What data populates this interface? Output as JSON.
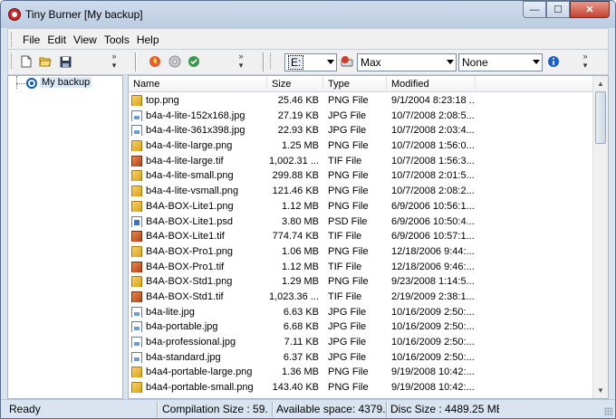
{
  "window": {
    "title": "Tiny Burner [My backup]",
    "buttons": {
      "minimize": "—",
      "maximize": "☐",
      "close": "✕"
    }
  },
  "menu": {
    "items": [
      "File",
      "Edit",
      "View",
      "Tools",
      "Help"
    ]
  },
  "toolbar": {
    "chevron": "»",
    "drive": {
      "value": "E:"
    },
    "speed": {
      "value": "Max"
    },
    "verify": {
      "value": "None"
    }
  },
  "tree": {
    "root_label": "My backup"
  },
  "list": {
    "columns": [
      "Name",
      "Size",
      "Type",
      "Modified"
    ],
    "rows": [
      {
        "name": "top.png",
        "size": "25.46 KB",
        "type": "PNG File",
        "modified": "9/1/2004 8:23:18 ...",
        "icon": "png"
      },
      {
        "name": "b4a-4-lite-152x168.jpg",
        "size": "27.19 KB",
        "type": "JPG File",
        "modified": "10/7/2008 2:08:5...",
        "icon": "jpg"
      },
      {
        "name": "b4a-4-lite-361x398.jpg",
        "size": "22.93 KB",
        "type": "JPG File",
        "modified": "10/7/2008 2:03:4...",
        "icon": "jpg"
      },
      {
        "name": "b4a-4-lite-large.png",
        "size": "1.25 MB",
        "type": "PNG File",
        "modified": "10/7/2008 1:56:0...",
        "icon": "png"
      },
      {
        "name": "b4a-4-lite-large.tif",
        "size": "1,002.31 ...",
        "type": "TIF File",
        "modified": "10/7/2008 1:56:3...",
        "icon": "tif"
      },
      {
        "name": "b4a-4-lite-small.png",
        "size": "299.88 KB",
        "type": "PNG File",
        "modified": "10/7/2008 2:01:5...",
        "icon": "png"
      },
      {
        "name": "b4a-4-lite-vsmall.png",
        "size": "121.46 KB",
        "type": "PNG File",
        "modified": "10/7/2008 2:08:2...",
        "icon": "png"
      },
      {
        "name": "B4A-BOX-Lite1.png",
        "size": "1.12 MB",
        "type": "PNG File",
        "modified": "6/9/2006 10:56:1...",
        "icon": "png"
      },
      {
        "name": "B4A-BOX-Lite1.psd",
        "size": "3.80 MB",
        "type": "PSD File",
        "modified": "6/9/2006 10:50:4...",
        "icon": "psd"
      },
      {
        "name": "B4A-BOX-Lite1.tif",
        "size": "774.74 KB",
        "type": "TIF File",
        "modified": "6/9/2006 10:57:1...",
        "icon": "tif"
      },
      {
        "name": "B4A-BOX-Pro1.png",
        "size": "1.06 MB",
        "type": "PNG File",
        "modified": "12/18/2006 9:44:...",
        "icon": "png"
      },
      {
        "name": "B4A-BOX-Pro1.tif",
        "size": "1.12 MB",
        "type": "TIF File",
        "modified": "12/18/2006 9:46:...",
        "icon": "tif"
      },
      {
        "name": "B4A-BOX-Std1.png",
        "size": "1.29 MB",
        "type": "PNG File",
        "modified": "9/23/2008 1:14:5...",
        "icon": "png"
      },
      {
        "name": "B4A-BOX-Std1.tif",
        "size": "1,023.36 ...",
        "type": "TIF File",
        "modified": "2/19/2009 2:38:1...",
        "icon": "tif"
      },
      {
        "name": "b4a-lite.jpg",
        "size": "6.63 KB",
        "type": "JPG File",
        "modified": "10/16/2009 2:50:...",
        "icon": "jpg"
      },
      {
        "name": "b4a-portable.jpg",
        "size": "6.68 KB",
        "type": "JPG File",
        "modified": "10/16/2009 2:50:...",
        "icon": "jpg"
      },
      {
        "name": "b4a-professional.jpg",
        "size": "7.11 KB",
        "type": "JPG File",
        "modified": "10/16/2009 2:50:...",
        "icon": "jpg"
      },
      {
        "name": "b4a-standard.jpg",
        "size": "6.37 KB",
        "type": "JPG File",
        "modified": "10/16/2009 2:50:...",
        "icon": "jpg"
      },
      {
        "name": "b4a4-portable-large.png",
        "size": "1.36 MB",
        "type": "PNG File",
        "modified": "9/19/2008 10:42:...",
        "icon": "png"
      },
      {
        "name": "b4a4-portable-small.png",
        "size": "143.40 KB",
        "type": "PNG File",
        "modified": "9/19/2008 10:42:...",
        "icon": "png"
      }
    ]
  },
  "status": {
    "state": "Ready",
    "compilation": "Compilation Size : 59.",
    "available": "Available space: 4379.",
    "disc": "Disc Size : 4489.25 MB"
  }
}
